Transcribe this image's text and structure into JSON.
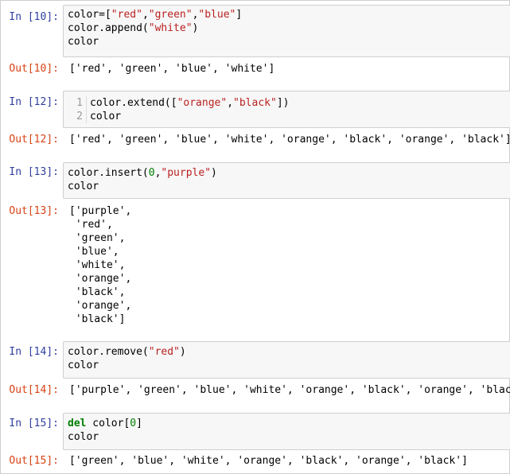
{
  "cells": [
    {
      "in_prompt": "In [10]:",
      "out_prompt": "Out[10]:",
      "code": [
        [
          {
            "t": "color=["
          },
          {
            "t": "\"red\"",
            "c": "str"
          },
          {
            "t": ","
          },
          {
            "t": "\"green\"",
            "c": "str"
          },
          {
            "t": ","
          },
          {
            "t": "\"blue\"",
            "c": "str"
          },
          {
            "t": "]"
          }
        ],
        [
          {
            "t": "color.append("
          },
          {
            "t": "\"white\"",
            "c": "str"
          },
          {
            "t": ")"
          }
        ],
        [
          {
            "t": "color"
          }
        ]
      ],
      "output": [
        "['red', 'green', 'blue', 'white']"
      ]
    },
    {
      "in_prompt": "In [12]:",
      "out_prompt": "Out[12]:",
      "line_numbers": [
        "1",
        "2"
      ],
      "code": [
        [
          {
            "t": "color.extend(["
          },
          {
            "t": "\"orange\"",
            "c": "str"
          },
          {
            "t": ","
          },
          {
            "t": "\"black\"",
            "c": "str"
          },
          {
            "t": "])"
          }
        ],
        [
          {
            "t": "color"
          }
        ]
      ],
      "output": [
        "['red', 'green', 'blue', 'white', 'orange', 'black', 'orange', 'black']"
      ]
    },
    {
      "in_prompt": "In [13]:",
      "out_prompt": "Out[13]:",
      "code": [
        [
          {
            "t": "color.insert("
          },
          {
            "t": "0",
            "c": "num"
          },
          {
            "t": ","
          },
          {
            "t": "\"purple\"",
            "c": "str"
          },
          {
            "t": ")"
          }
        ],
        [
          {
            "t": "color"
          }
        ]
      ],
      "output": [
        "['purple',",
        " 'red',",
        " 'green',",
        " 'blue',",
        " 'white',",
        " 'orange',",
        " 'black',",
        " 'orange',",
        " 'black']"
      ]
    },
    {
      "in_prompt": "In [14]:",
      "out_prompt": "Out[14]:",
      "code": [
        [
          {
            "t": "color.remove("
          },
          {
            "t": "\"red\"",
            "c": "str"
          },
          {
            "t": ")"
          }
        ],
        [
          {
            "t": "color"
          }
        ]
      ],
      "output": [
        "['purple', 'green', 'blue', 'white', 'orange', 'black', 'orange', 'black']"
      ]
    },
    {
      "in_prompt": "In [15]:",
      "out_prompt": "Out[15]:",
      "code": [
        [
          {
            "t": "del",
            "c": "kw"
          },
          {
            "t": " color["
          },
          {
            "t": "0",
            "c": "num"
          },
          {
            "t": "]"
          }
        ],
        [
          {
            "t": "color"
          }
        ]
      ],
      "output": [
        "['green', 'blue', 'white', 'orange', 'black', 'orange', 'black']"
      ]
    }
  ],
  "colors": {
    "in_prompt": "#303f9f",
    "out_prompt": "#d84315",
    "string": "#ba2121",
    "keyword": "#008000",
    "number": "#008000",
    "cell_background": "#f7f7f7"
  }
}
